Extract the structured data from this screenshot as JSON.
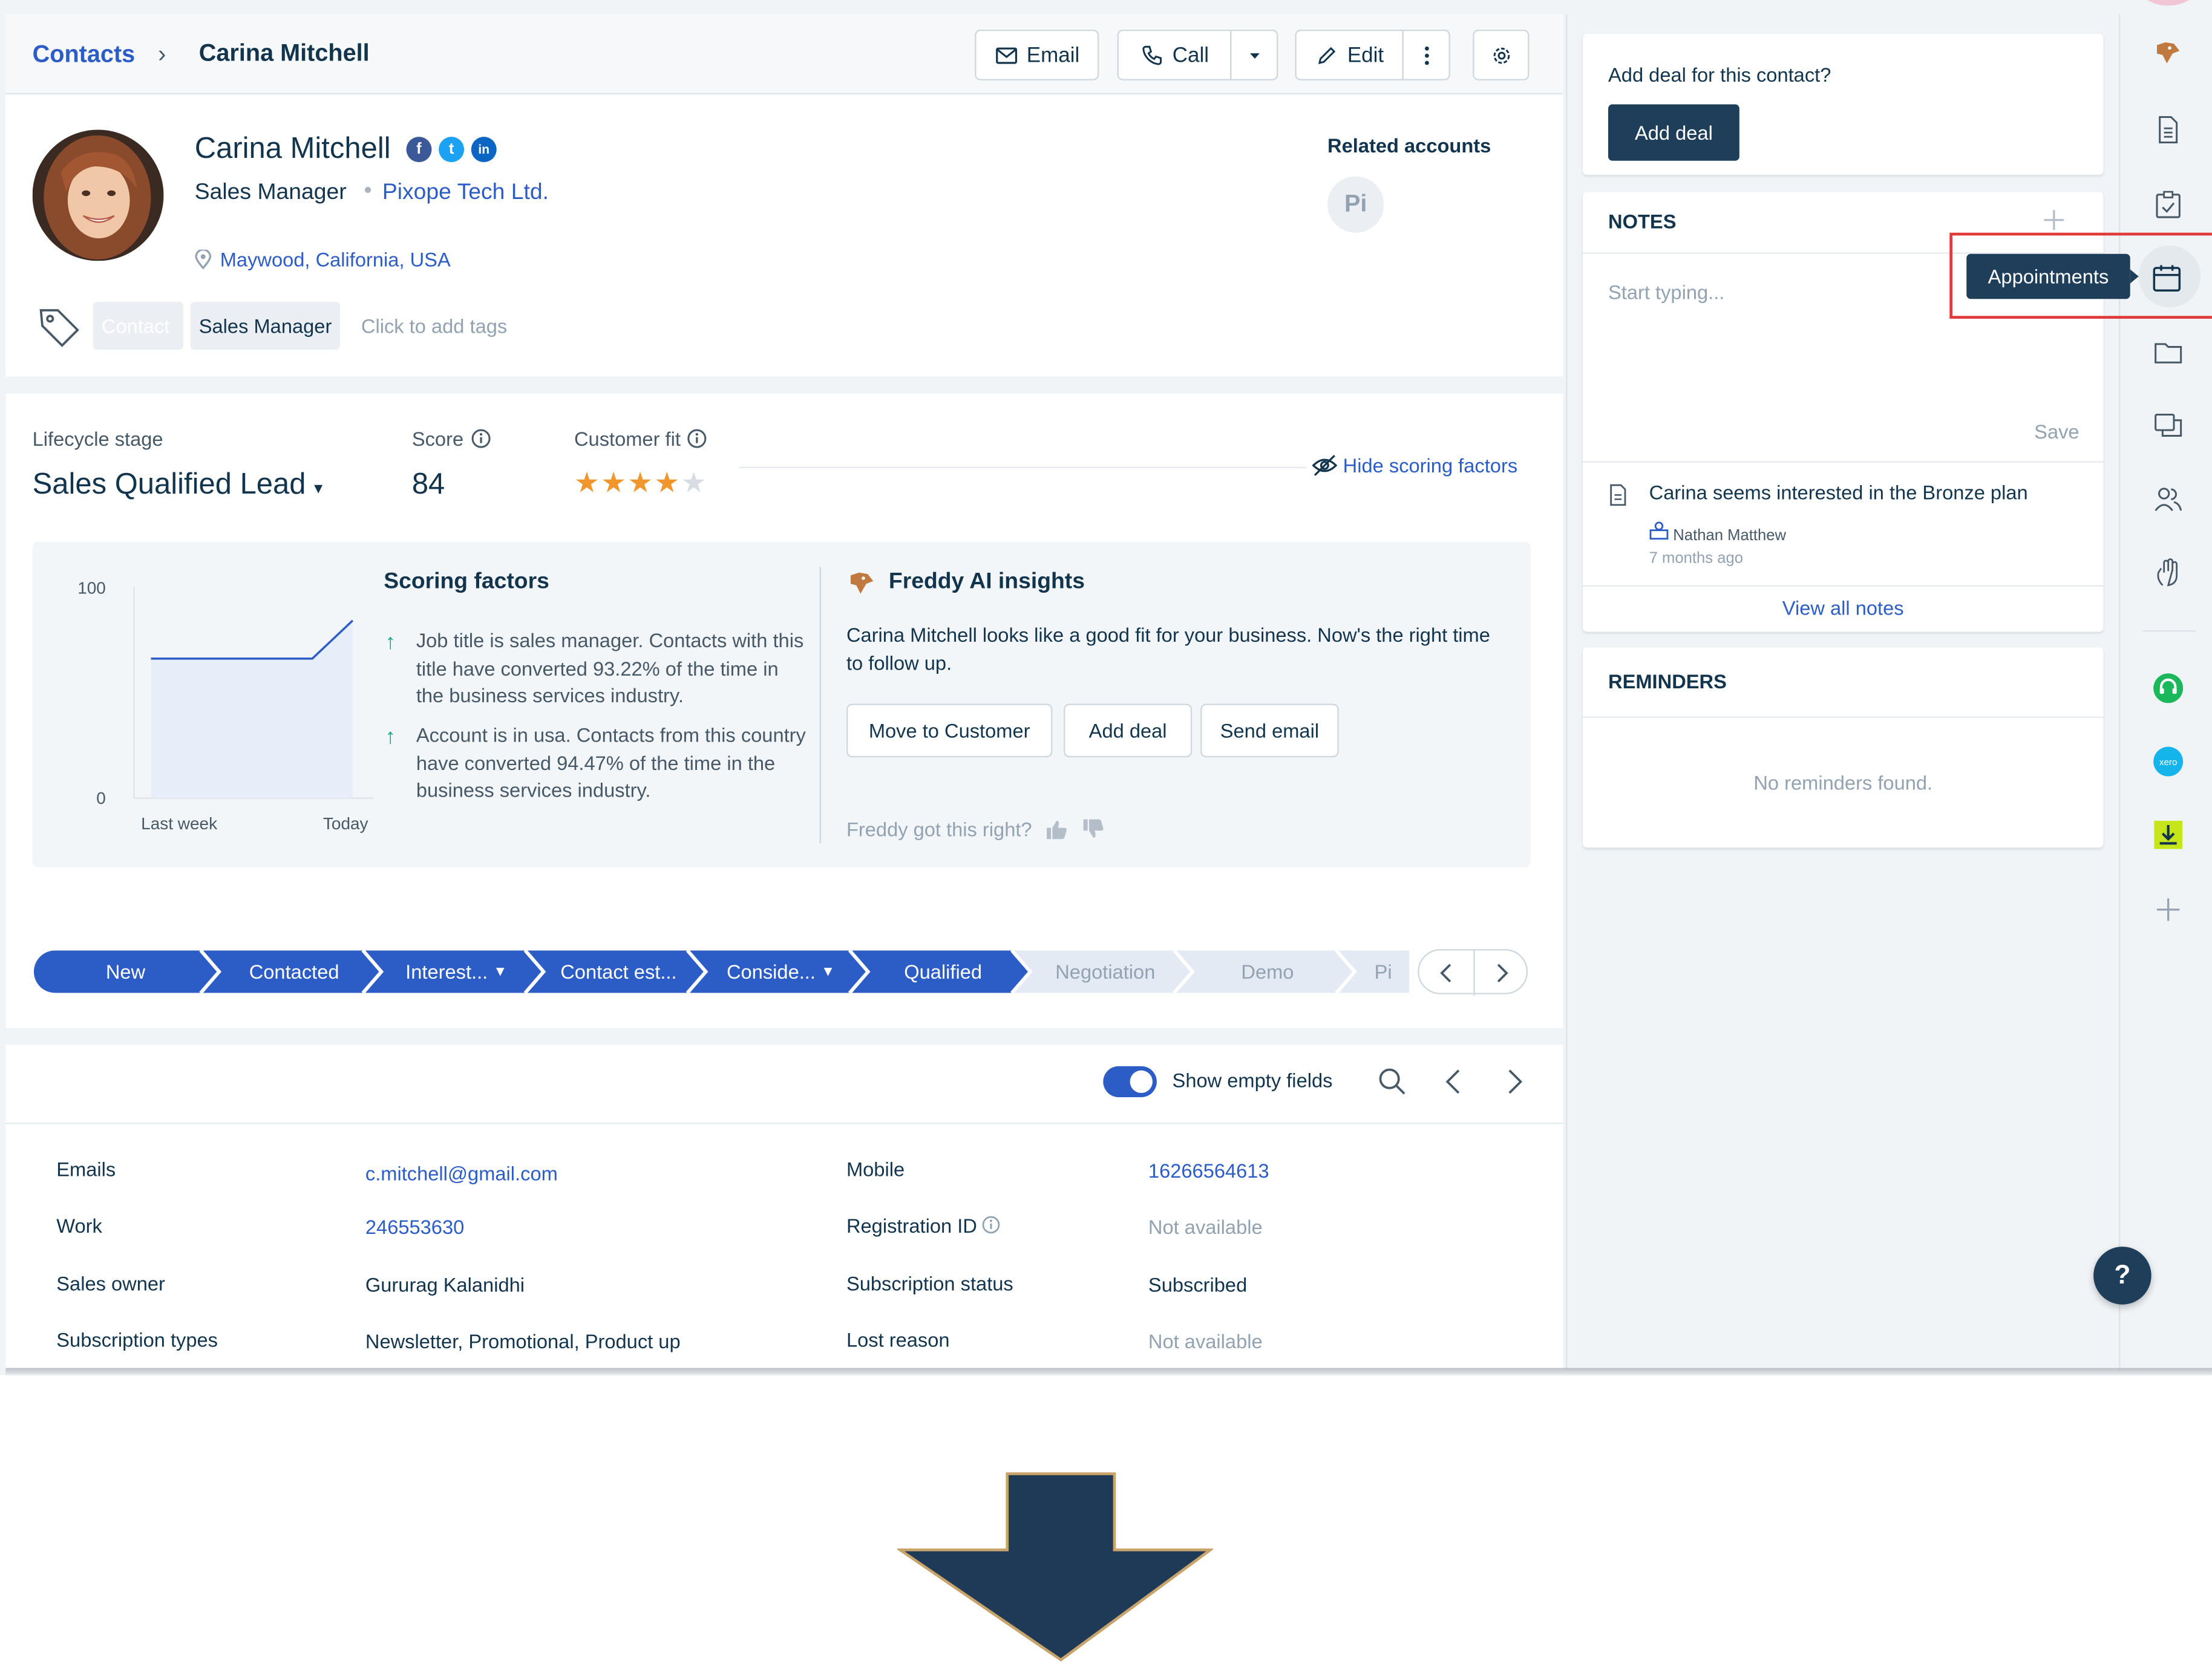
{
  "breadcrumb": {
    "root": "Contacts",
    "separator": "›",
    "current": "Carina Mitchell"
  },
  "toolbar": {
    "email": "Email",
    "call": "Call",
    "edit": "Edit"
  },
  "contact": {
    "name": "Carina Mitchell",
    "job_title": "Sales Manager",
    "company": "Pixope Tech Ltd.",
    "location": "Maywood, California, USA",
    "social": [
      "f",
      "t",
      "in"
    ],
    "tags": [
      "Contact",
      "Sales Manager"
    ],
    "tag_placeholder": "Click to add tags",
    "related_accounts_label": "Related accounts",
    "related_account_initials": "Pi"
  },
  "lifecycle": {
    "label": "Lifecycle stage",
    "value": "Sales Qualified Lead"
  },
  "score": {
    "label": "Score",
    "value": "84"
  },
  "customer_fit": {
    "label": "Customer fit",
    "stars": 4,
    "max": 5
  },
  "hide_scoring": "Hide scoring factors",
  "scoring_chart": {
    "y_max": "100",
    "y_min": "0",
    "x_start": "Last week",
    "x_end": "Today"
  },
  "chart_data": {
    "type": "area",
    "x": [
      "Last week",
      "Today"
    ],
    "series": [
      {
        "values": [
          66,
          66,
          66,
          66,
          66,
          84
        ]
      }
    ],
    "ylim": [
      0,
      100
    ]
  },
  "scoring_factors": {
    "title": "Scoring factors",
    "items": [
      "Job title is sales manager. Contacts with this title have converted 93.22% of the time in the business services industry.",
      "Account is in usa. Contacts from this country have converted 94.47% of the time in the business services industry."
    ]
  },
  "freddy": {
    "title": "Freddy AI insights",
    "text": "Carina Mitchell looks like a good fit for your business. Now's the right time to follow up.",
    "buttons": [
      "Move to Customer",
      "Add deal",
      "Send email"
    ],
    "feedback": "Freddy got this right?"
  },
  "pipeline": {
    "stages": [
      "New",
      "Contacted",
      "Interest...",
      "Contact est...",
      "Conside...",
      "Qualified",
      "Negotiation",
      "Demo",
      "Pi"
    ],
    "completed_count": 6
  },
  "fields_toolbar": {
    "toggle_label": "Show empty fields"
  },
  "fields": {
    "left": [
      {
        "label": "Emails",
        "value": "c.mitchell@gmail.com",
        "kind": "link"
      },
      {
        "label": "Work",
        "value": "246553630",
        "kind": "link"
      },
      {
        "label": "Sales owner",
        "value": "Gururag Kalanidhi",
        "kind": "text"
      },
      {
        "label": "Subscription types",
        "value": "Newsletter, Promotional, Product up",
        "kind": "text"
      }
    ],
    "right": [
      {
        "label": "Mobile",
        "value": "16266564613",
        "kind": "link"
      },
      {
        "label": "Registration ID",
        "value": "Not available",
        "kind": "muted"
      },
      {
        "label": "Subscription status",
        "value": "Subscribed",
        "kind": "text"
      },
      {
        "label": "Lost reason",
        "value": "Not available",
        "kind": "muted"
      }
    ]
  },
  "deal_card": {
    "prompt": "Add deal for this contact?",
    "button": "Add deal"
  },
  "notes": {
    "title": "NOTES",
    "placeholder": "Start typing...",
    "save": "Save",
    "note_text": "Carina seems interested in the Bronze plan",
    "author": "Nathan Matthew",
    "time": "7 months ago",
    "view_all": "View all notes"
  },
  "reminders": {
    "title": "REMINDERS",
    "empty": "No reminders found."
  },
  "tooltip": "Appointments",
  "help": "?",
  "colors": {
    "primary": "#2c5cc5",
    "navy": "#1e3e5a",
    "accent_highlight": "#e03a3a",
    "star": "#f0962c"
  }
}
